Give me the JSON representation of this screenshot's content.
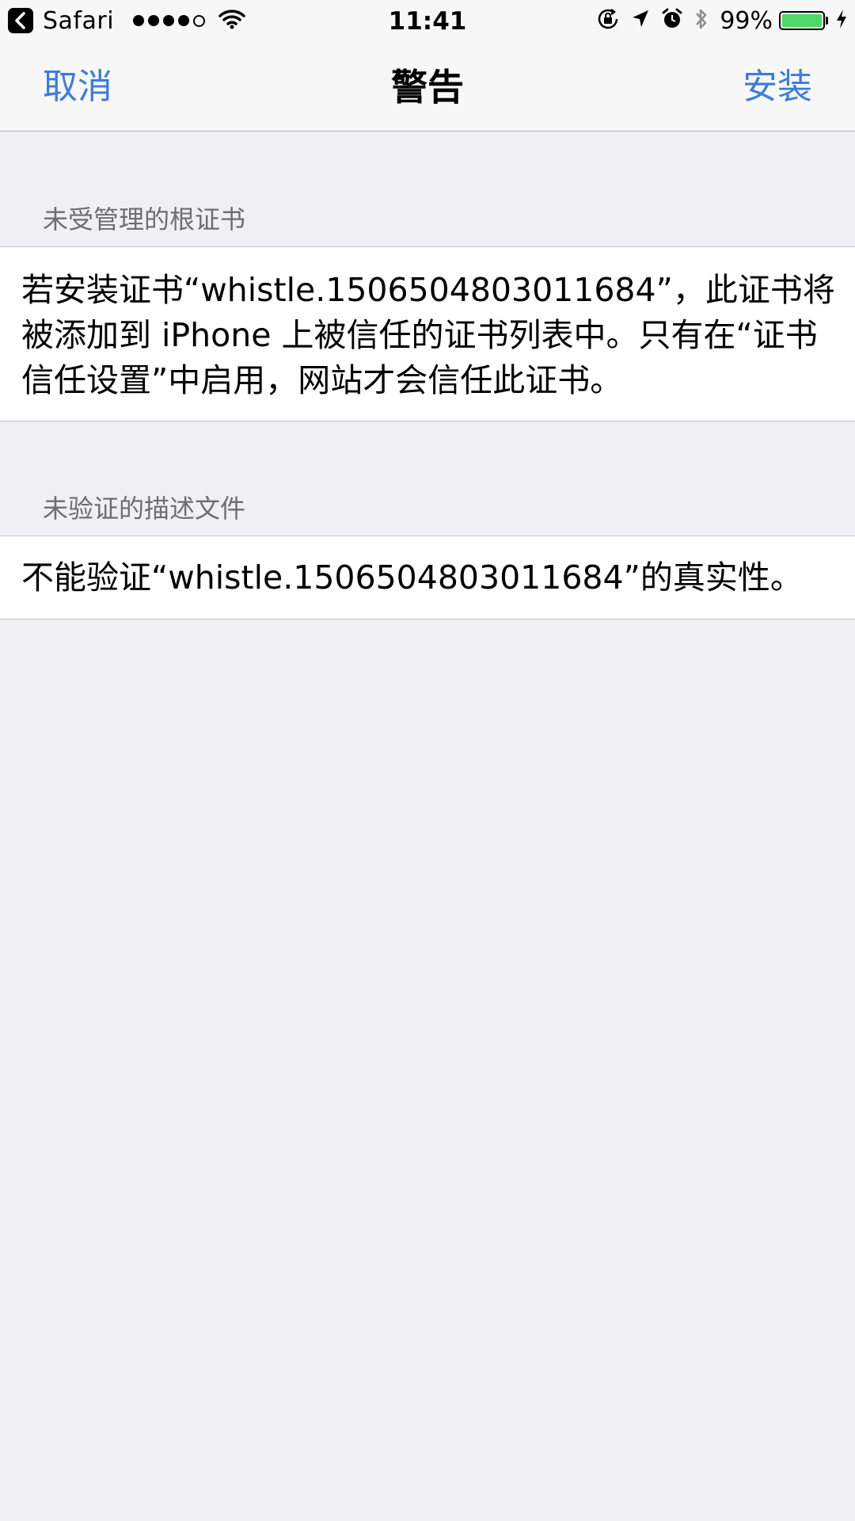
{
  "status_bar": {
    "back_app": "Safari",
    "time": "11:41",
    "battery_percent": "99%",
    "battery_level": 0.99,
    "signal_bars_filled": 4,
    "signal_bars_total": 5,
    "icons": [
      "back-arrow-icon",
      "wifi-icon",
      "rotation-lock-icon",
      "location-icon",
      "alarm-icon",
      "bluetooth-icon",
      "battery-icon",
      "charging-icon"
    ]
  },
  "nav": {
    "cancel": "取消",
    "title": "警告",
    "install": "安装",
    "accent_color": "#3b7ddd"
  },
  "sections": [
    {
      "header": "未受管理的根证书",
      "body": "若安装证书“whistle.1506504803011684”，此证书将被添加到 iPhone 上被信任的证书列表中。只有在“证书信任设置”中启用，网站才会信任此证书。"
    },
    {
      "header": "未验证的描述文件",
      "body": "不能验证“whistle.1506504803011684”的真实性。"
    }
  ],
  "colors": {
    "background": "#efeff4",
    "bar_background": "#f7f7f7",
    "section_header": "#6d6d72",
    "battery_fill": "#4cd964"
  }
}
